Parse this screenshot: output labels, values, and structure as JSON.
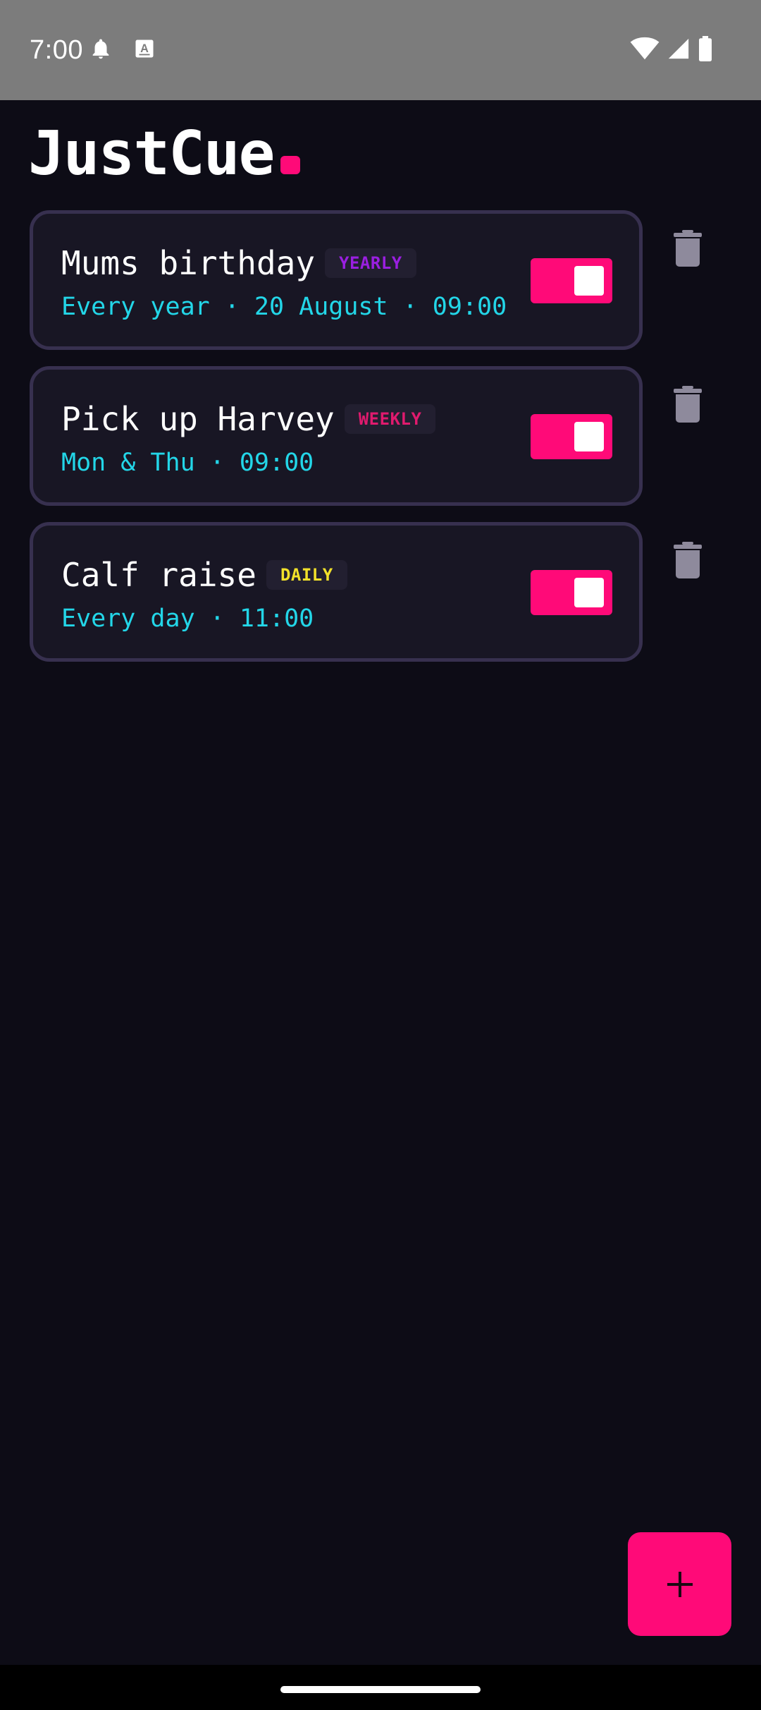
{
  "status_bar": {
    "time": "7:00",
    "icons_left": [
      "bell-icon",
      "keyboard-a-icon"
    ],
    "icons_right": [
      "wifi-icon",
      "cell-signal-icon",
      "battery-icon"
    ]
  },
  "app": {
    "title": "JustCue",
    "accent_color": "#ff0a78",
    "background_color": "#0d0c16"
  },
  "reminders": [
    {
      "title": "Mums birthday",
      "frequency": "YEARLY",
      "frequency_color": "#9a1fe0",
      "schedule": "Every year · 20 August · 09:00",
      "enabled": true
    },
    {
      "title": "Pick up Harvey",
      "frequency": "WEEKLY",
      "frequency_color": "#e01a6e",
      "schedule": "Mon & Thu · 09:00",
      "enabled": true
    },
    {
      "title": "Calf raise",
      "frequency": "DAILY",
      "frequency_color": "#f2e12a",
      "schedule": "Every day · 11:00",
      "enabled": true
    }
  ],
  "fab": {
    "icon": "plus-icon"
  }
}
